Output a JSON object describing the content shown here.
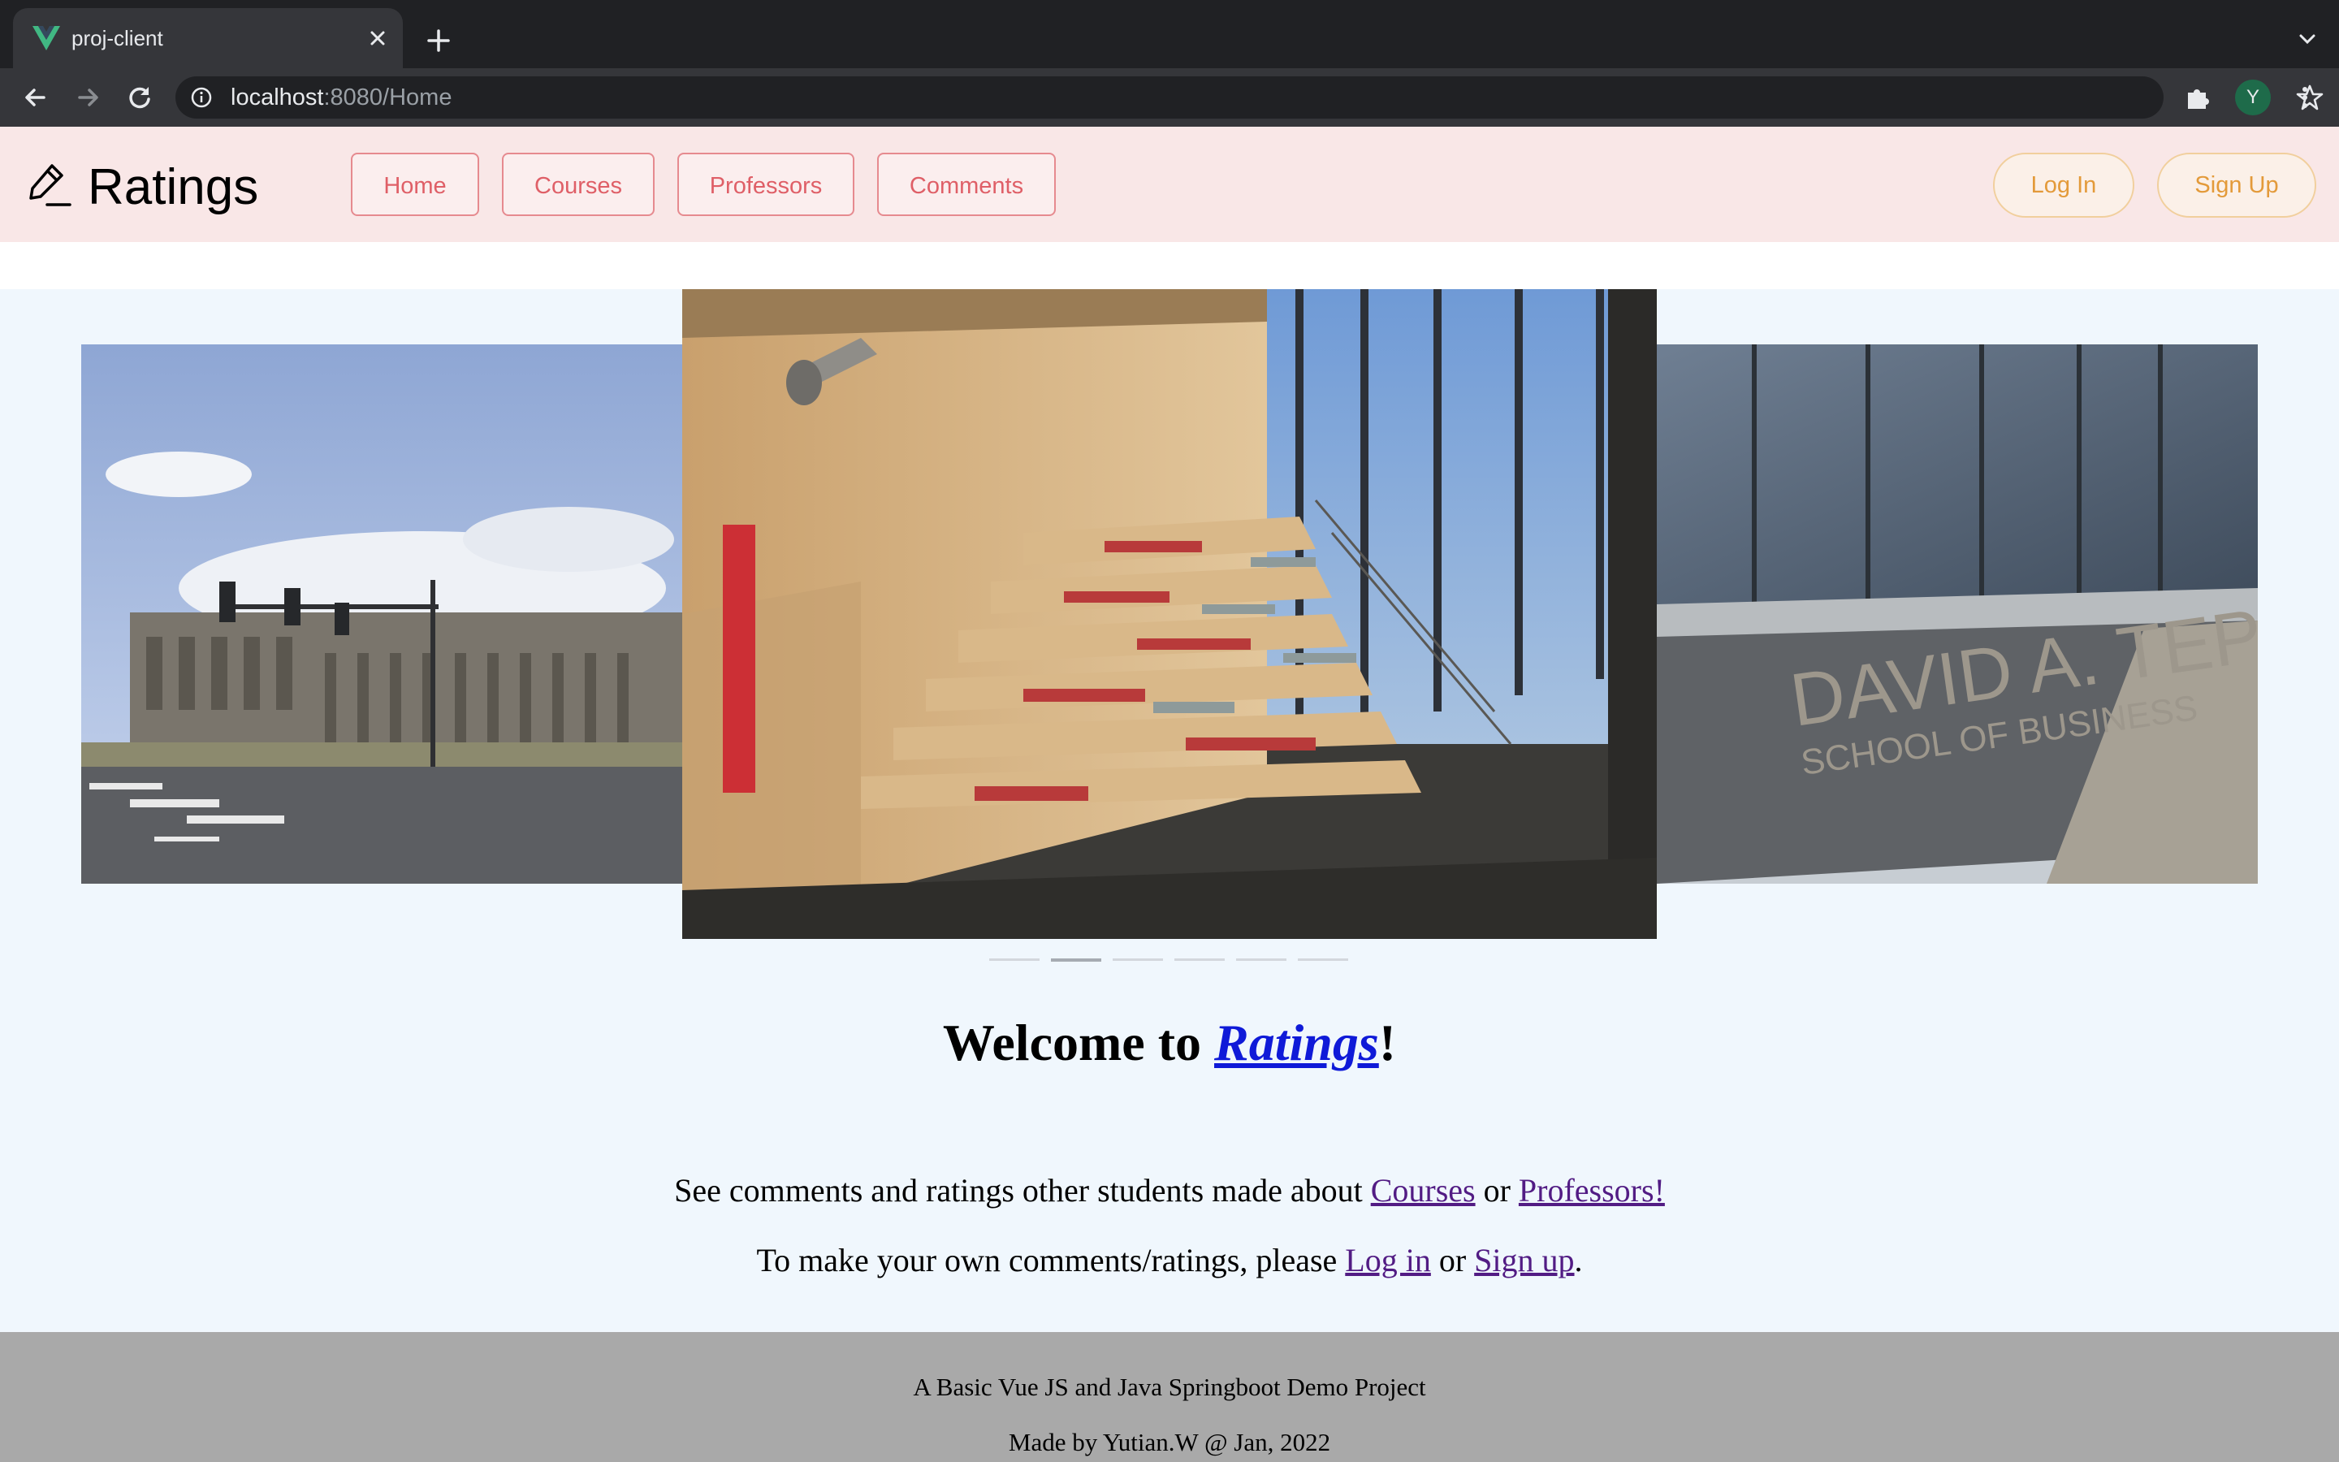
{
  "browser": {
    "tab_title": "proj-client",
    "url_host": "localhost",
    "url_rest": ":8080/Home",
    "profile_initial": "Y",
    "icons": [
      "vue-favicon-icon",
      "close-icon",
      "plus-icon",
      "chevron-down-icon",
      "back-arrow-icon",
      "forward-arrow-icon",
      "reload-icon",
      "info-icon",
      "share-icon",
      "star-icon",
      "puzzle-extension-icon",
      "kebab-menu-icon"
    ]
  },
  "header": {
    "brand": "Ratings",
    "brand_icon": "pencil-icon",
    "nav": [
      "Home",
      "Courses",
      "Professors",
      "Comments"
    ],
    "login": "Log In",
    "signup": "Sign Up",
    "colors": {
      "nav_border": "#e68a8f",
      "nav_text": "#df5f67",
      "auth_border": "#f1cf9d",
      "auth_text": "#e39a3a",
      "header_bg": "#f9e7e7"
    }
  },
  "carousel": {
    "slides": [
      "campus-street-photo",
      "atrium-staircase-photo",
      "tepper-school-sign-photo"
    ],
    "sign_line1": "DAVID A. TEPPER",
    "sign_line2": "SCHOOL OF BUSINESS",
    "indicator_count": 6,
    "active_index": 1
  },
  "content": {
    "welcome_prefix": "Welcome to ",
    "welcome_link": "Ratings",
    "welcome_suffix": "!",
    "line1_text": "See comments and ratings other students made about ",
    "line1_link1": "Courses",
    "line1_mid": " or ",
    "line1_link2": "Professors!",
    "line2_text": "To make your own comments/ratings, please ",
    "line2_link1": "Log in",
    "line2_mid": " or ",
    "line2_link2": "Sign up",
    "line2_end": "."
  },
  "footer": {
    "line1": "A Basic Vue JS and Java Springboot Demo Project",
    "line2": "Made by Yutian.W @ Jan, 2022"
  }
}
